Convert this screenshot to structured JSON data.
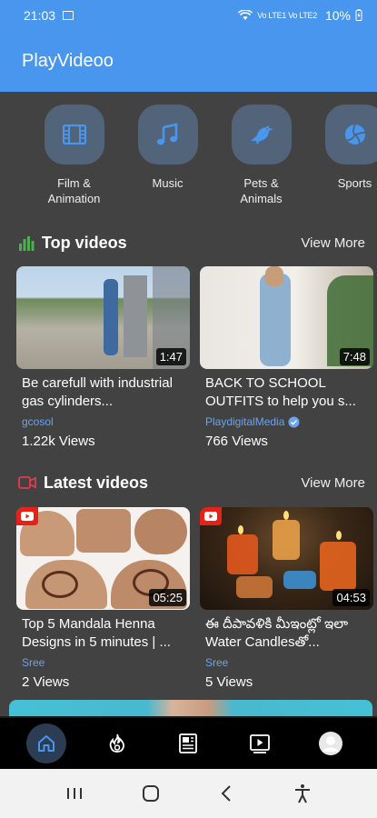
{
  "status_bar": {
    "time": "21:03",
    "signal_text": "Vo LTE1 Vo LTE2",
    "battery": "10%"
  },
  "app_bar": {
    "title": "PlayVideoo"
  },
  "categories": [
    {
      "label": "Film &\nAnimation",
      "icon": "film-icon"
    },
    {
      "label": "Music",
      "icon": "music-note-icon"
    },
    {
      "label": "Pets &\nAnimals",
      "icon": "bird-icon"
    },
    {
      "label": "Sports",
      "icon": "volleyball-icon"
    }
  ],
  "top_videos": {
    "title": "Top videos",
    "view_more": "View More",
    "items": [
      {
        "title": "Be carefull with industrial gas cylinders...",
        "channel": "gcosol",
        "views": "1.22k Views",
        "duration": "1:47",
        "verified": false
      },
      {
        "title": "BACK TO SCHOOL OUTFITS to help you s...",
        "channel": "PlaydigitalMedia",
        "views": "766 Views",
        "duration": "7:48",
        "verified": true
      }
    ]
  },
  "latest_videos": {
    "title": "Latest videos",
    "view_more": "View More",
    "items": [
      {
        "title": "Top 5 Mandala Henna Designs in 5 minutes | ...",
        "channel": "Sree",
        "views": "2 Views",
        "duration": "05:25"
      },
      {
        "title": "ఈ దీపావళికి మీఇంట్లో ఇలా Water Candlesతో...",
        "channel": "Sree",
        "views": "5 Views",
        "duration": "04:53"
      }
    ]
  },
  "bottom_nav": [
    {
      "name": "home",
      "icon": "home-icon",
      "active": true
    },
    {
      "name": "trending",
      "icon": "flame-icon",
      "active": false
    },
    {
      "name": "news",
      "icon": "newspaper-icon",
      "active": false
    },
    {
      "name": "subscriptions",
      "icon": "video-library-icon",
      "active": false
    },
    {
      "name": "profile",
      "icon": "avatar-icon",
      "active": false
    }
  ],
  "colors": {
    "primary": "#4896ee",
    "background": "#424242",
    "link": "#6aa3ee",
    "top_videos_accent": "#4caf50",
    "latest_videos_accent": "#e53950"
  }
}
